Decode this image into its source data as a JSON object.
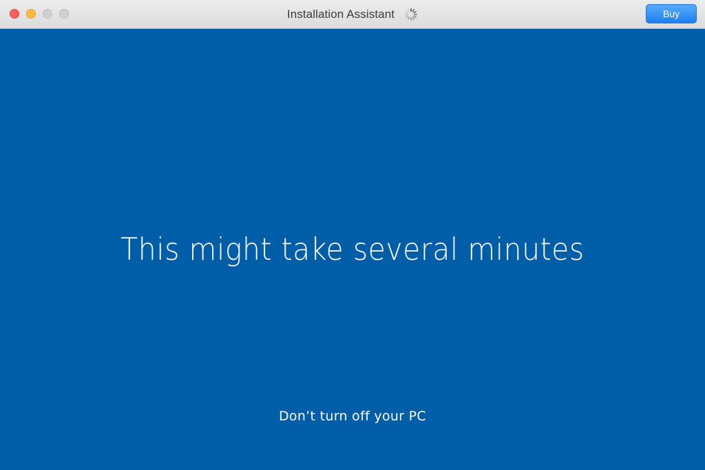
{
  "window": {
    "title": "Installation Assistant",
    "buy_label": "Buy",
    "loading": true,
    "spinner_icon": "loading-spinner-icon"
  },
  "content": {
    "headline": "This might take several minutes",
    "subline": "Don’t turn off your PC"
  },
  "colors": {
    "background": "#005ea8",
    "titlebar": "#e4e4e4",
    "close": "#fc605c",
    "minimize": "#fdbc40",
    "buy_button": "#2b8cf5",
    "text": "#ffffff"
  }
}
